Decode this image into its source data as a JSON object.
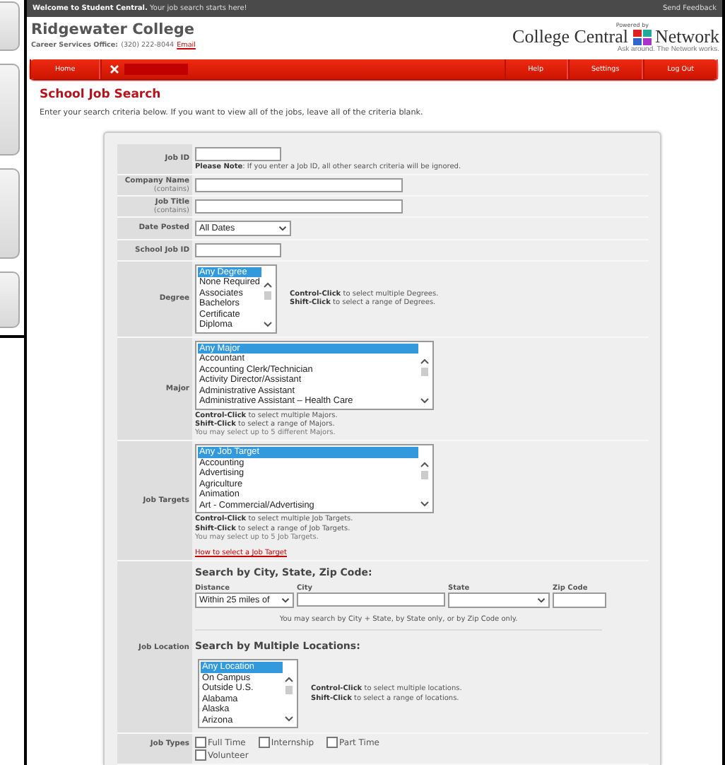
{
  "top_bar": {
    "welcome": "**Welcome to Student Central.** Your job search starts here!",
    "feedback": "Send Feedback"
  },
  "header": {
    "college": "Ridgewater College",
    "office_label": "Career Services Office:",
    "phone": "(320) 222-8044",
    "email": "Email",
    "powered_by": "Powered by",
    "logo_left": "College Central",
    "logo_right": "Network",
    "tagline": "Ask around. The Network works."
  },
  "nav": {
    "left": [
      {
        "kind": "link",
        "label": "Home"
      },
      {
        "kind": "redacted"
      }
    ],
    "right": [
      {
        "kind": "link",
        "label": "Help"
      },
      {
        "kind": "link",
        "label": "Settings"
      },
      {
        "kind": "link",
        "label": "Log Out"
      }
    ]
  },
  "page_title": "School Job Search",
  "intro": "Enter your search criteria below. If you want to view all of the jobs, leave all of the criteria blank.",
  "form": {
    "rows": [
      {
        "kind": "short_text",
        "label": "Job ID",
        "note": "**Please Note**: If you enter a Job ID, all other search criteria will be ignored."
      },
      {
        "kind": "long_text",
        "label": "Company Name",
        "sublabel": "(contains)"
      },
      {
        "kind": "long_text",
        "label": "Job Title",
        "sublabel": "(contains)"
      },
      {
        "kind": "select",
        "label": "Date Posted",
        "value": "All Dates"
      },
      {
        "kind": "short_text",
        "label": "School Job ID"
      },
      {
        "kind": "side_listbox",
        "label": "Degree",
        "options": [
          {
            "label": "Any Degree",
            "selected": true
          },
          {
            "label": "None Required",
            "selected": false
          },
          {
            "label": "Associates",
            "selected": false
          },
          {
            "label": "Bachelors",
            "selected": false
          },
          {
            "label": "Certificate",
            "selected": false
          },
          {
            "label": "Diploma",
            "selected": false
          }
        ],
        "hints": [
          "**Control-Click** to select multiple Degrees.",
          "**Shift-Click** to select a range of Degrees."
        ]
      },
      {
        "kind": "listbox",
        "label": "Major",
        "options": [
          {
            "label": "Any Major",
            "selected": true
          },
          {
            "label": "Accountant",
            "selected": false
          },
          {
            "label": "Accounting Clerk/Technician",
            "selected": false
          },
          {
            "label": "Activity Director/Assistant",
            "selected": false
          },
          {
            "label": "Administrative Assistant",
            "selected": false
          },
          {
            "label": "Administrative Assistant – Health Care",
            "selected": false
          }
        ],
        "hints": [
          "**Control-Click** to select multiple Majors.",
          "**Shift-Click** to select a range of Majors."
        ],
        "limit": "You may select up to 5 different Majors."
      },
      {
        "kind": "listbox",
        "label": "Job Targets",
        "options": [
          {
            "label": "Any Job Target",
            "selected": true
          },
          {
            "label": "Accounting",
            "selected": false
          },
          {
            "label": "Advertising",
            "selected": false
          },
          {
            "label": "Agriculture",
            "selected": false
          },
          {
            "label": "Animation",
            "selected": false
          },
          {
            "label": "Art - Commercial/Advertising",
            "selected": false
          }
        ],
        "hints": [
          "**Control-Click** to select multiple Job Targets.",
          "**Shift-Click** to select a range of Job Targets."
        ],
        "limit": "You may select up to 5 Job Targets.",
        "link": "How to select a Job Target"
      },
      {
        "kind": "location",
        "label": "Job Location",
        "heading": "Search by City, State, Zip Code:",
        "distance_label": "Distance",
        "distance_value": "Within 25 miles of",
        "city_label": "City",
        "state_label": "State",
        "zip_label": "Zip Code",
        "note": "You may search by City + State, by State only, or by Zip Code only.",
        "heading2": "Search by Multiple Locations:",
        "options": [
          {
            "label": "Any Location",
            "selected": true
          },
          {
            "label": "On Campus",
            "selected": false
          },
          {
            "label": "Outside U.S.",
            "selected": false
          },
          {
            "label": "Alabama",
            "selected": false
          },
          {
            "label": "Alaska",
            "selected": false
          },
          {
            "label": "Arizona",
            "selected": false
          }
        ],
        "hints": [
          "**Control-Click** to select multiple locations.",
          "**Shift-Click** to select a range of locations."
        ]
      },
      {
        "kind": "checkboxes",
        "label": "Job Types",
        "items": [
          {
            "label": "Full Time",
            "checked": false
          },
          {
            "label": "Internship",
            "checked": false
          },
          {
            "label": "Part Time",
            "checked": false
          },
          {
            "label": "Volunteer",
            "checked": false
          }
        ]
      }
    ]
  }
}
